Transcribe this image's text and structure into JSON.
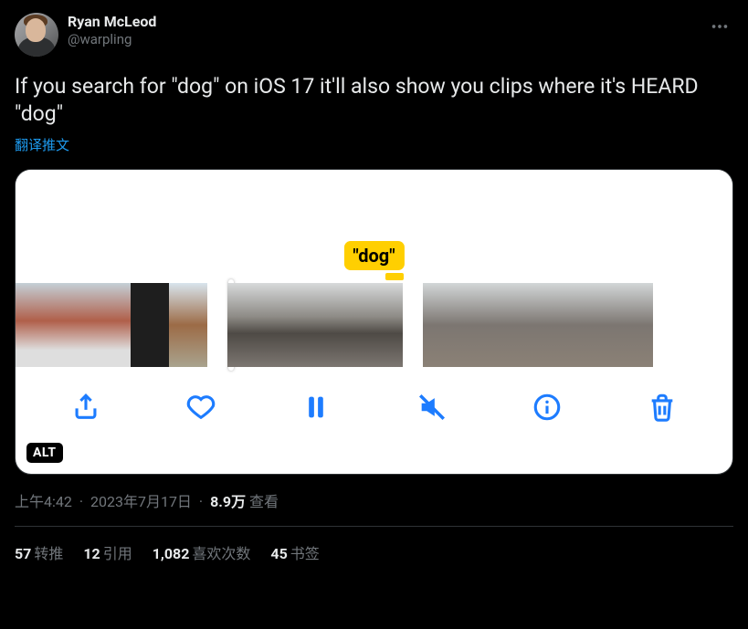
{
  "author": {
    "display_name": "Ryan McLeod",
    "handle": "@warpling"
  },
  "tweet_text": "If you search for \"dog\" on iOS 17 it'll also show you clips where it's HEARD \"dog\"",
  "translate_label": "翻译推文",
  "media": {
    "search_tag": "\"dog\"",
    "alt_badge": "ALT"
  },
  "meta": {
    "time": "上午4:42",
    "date": "2023年7月17日",
    "views_value": "8.9万",
    "views_label": "查看"
  },
  "stats": {
    "retweets": {
      "value": "57",
      "label": "转推"
    },
    "quotes": {
      "value": "12",
      "label": "引用"
    },
    "likes": {
      "value": "1,082",
      "label": "喜欢次数"
    },
    "bookmarks": {
      "value": "45",
      "label": "书签"
    }
  }
}
